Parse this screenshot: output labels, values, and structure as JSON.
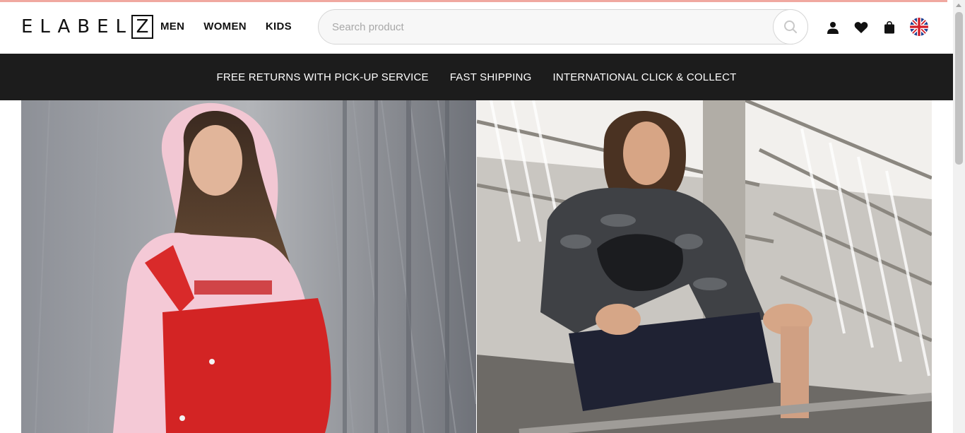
{
  "brand": {
    "logo_letters": "ELABEL",
    "logo_last": "Z"
  },
  "nav": {
    "men": "MEN",
    "women": "WOMEN",
    "kids": "KIDS"
  },
  "search": {
    "placeholder": "Search product",
    "value": ""
  },
  "header_icons": [
    "user-icon",
    "heart-icon",
    "shopping-bag-icon",
    "uk-flag-icon"
  ],
  "promo": {
    "returns": "FREE RETURNS WITH PICK-UP SERVICE",
    "shipping": "FAST SHIPPING",
    "collect": "INTERNATIONAL CLICK & COLLECT"
  },
  "hero": {
    "left_alt": "woman in pink hoodie and red dungarees",
    "right_alt": "young man in camouflage long sleeve and Nike waist bag"
  },
  "colors": {
    "accent_line": "#f0a8a0",
    "promo_bar": "#1c1c1c",
    "text": "#111111"
  }
}
